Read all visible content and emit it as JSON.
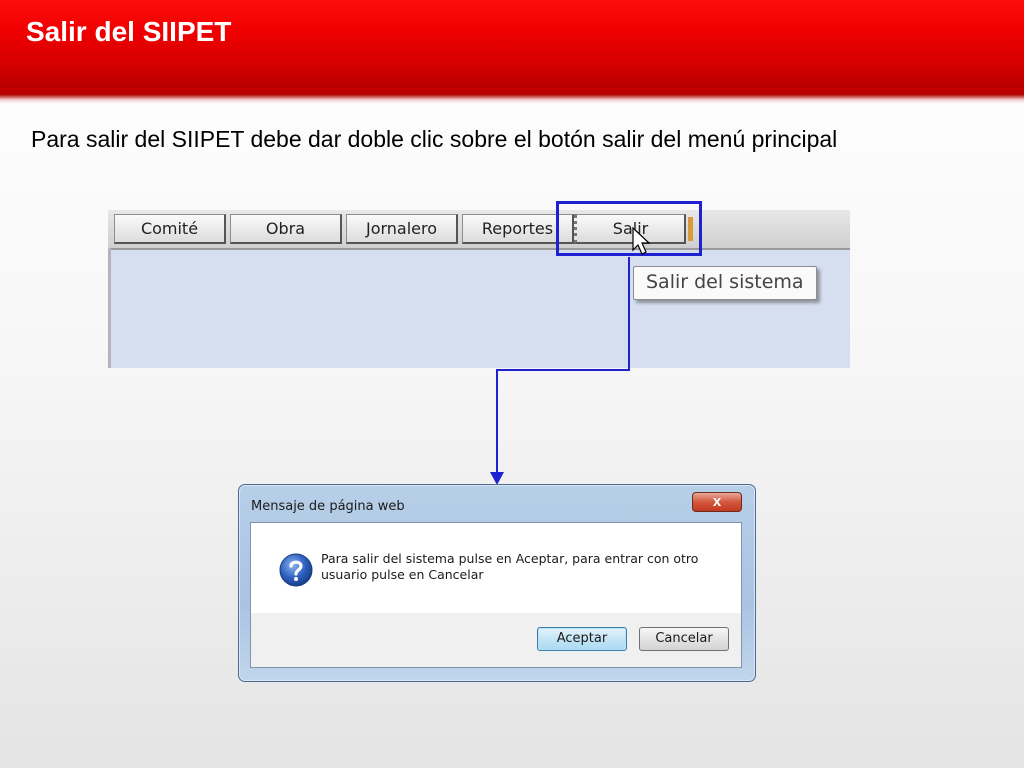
{
  "slide": {
    "title": "Salir del SIIPET",
    "instruction": "Para salir del SIIPET debe dar doble clic sobre el botón salir del menú principal",
    "colors": {
      "header": "#e30000",
      "highlight": "#1e22d0",
      "connector": "#1e22d0"
    }
  },
  "app_menu": {
    "buttons": [
      {
        "label": "Comité"
      },
      {
        "label": "Obra"
      },
      {
        "label": "Jornalero"
      },
      {
        "label": "Reportes"
      },
      {
        "label": "Salir",
        "active": true
      }
    ],
    "tooltip": "Salir del sistema",
    "cursor_icon": "arrow-cursor-icon"
  },
  "dialog": {
    "title": "Mensaje de página web",
    "close_label": "x",
    "icon": "question-icon",
    "message": "Para salir del sistema pulse en Aceptar, para entrar con otro usuario pulse en Cancelar",
    "accept_label": "Aceptar",
    "cancel_label": "Cancelar"
  }
}
